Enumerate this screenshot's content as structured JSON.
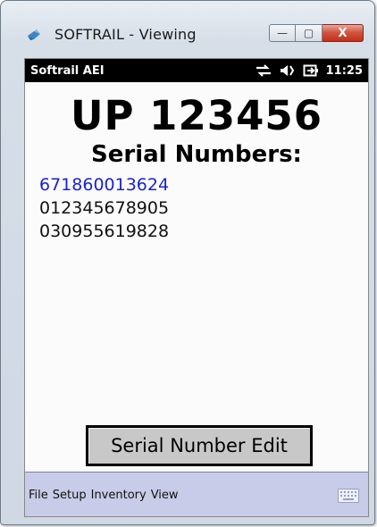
{
  "window": {
    "title": "SOFTRAIL - Viewing",
    "min_symbol": "—",
    "max_symbol": "▢",
    "close_symbol": "X"
  },
  "statusbar": {
    "app_name": "Softrail AEI",
    "time": "11:25",
    "icons": [
      "sync-arrows-icon",
      "speaker-icon",
      "battery-plug-icon"
    ]
  },
  "main": {
    "unit_number": "UP 123456",
    "serial_heading": "Serial Numbers:",
    "serials": [
      "671860013624",
      "012345678905",
      "030955619828"
    ],
    "selected_index": 0
  },
  "edit_button_label": "Serial Number Edit",
  "menubar": {
    "items": [
      "File",
      "Setup",
      "Inventory",
      "View"
    ]
  },
  "colors": {
    "selected_serial": "#1a22d8",
    "menubar_bg": "#c9cce8",
    "statusbar_bg": "#000000"
  }
}
